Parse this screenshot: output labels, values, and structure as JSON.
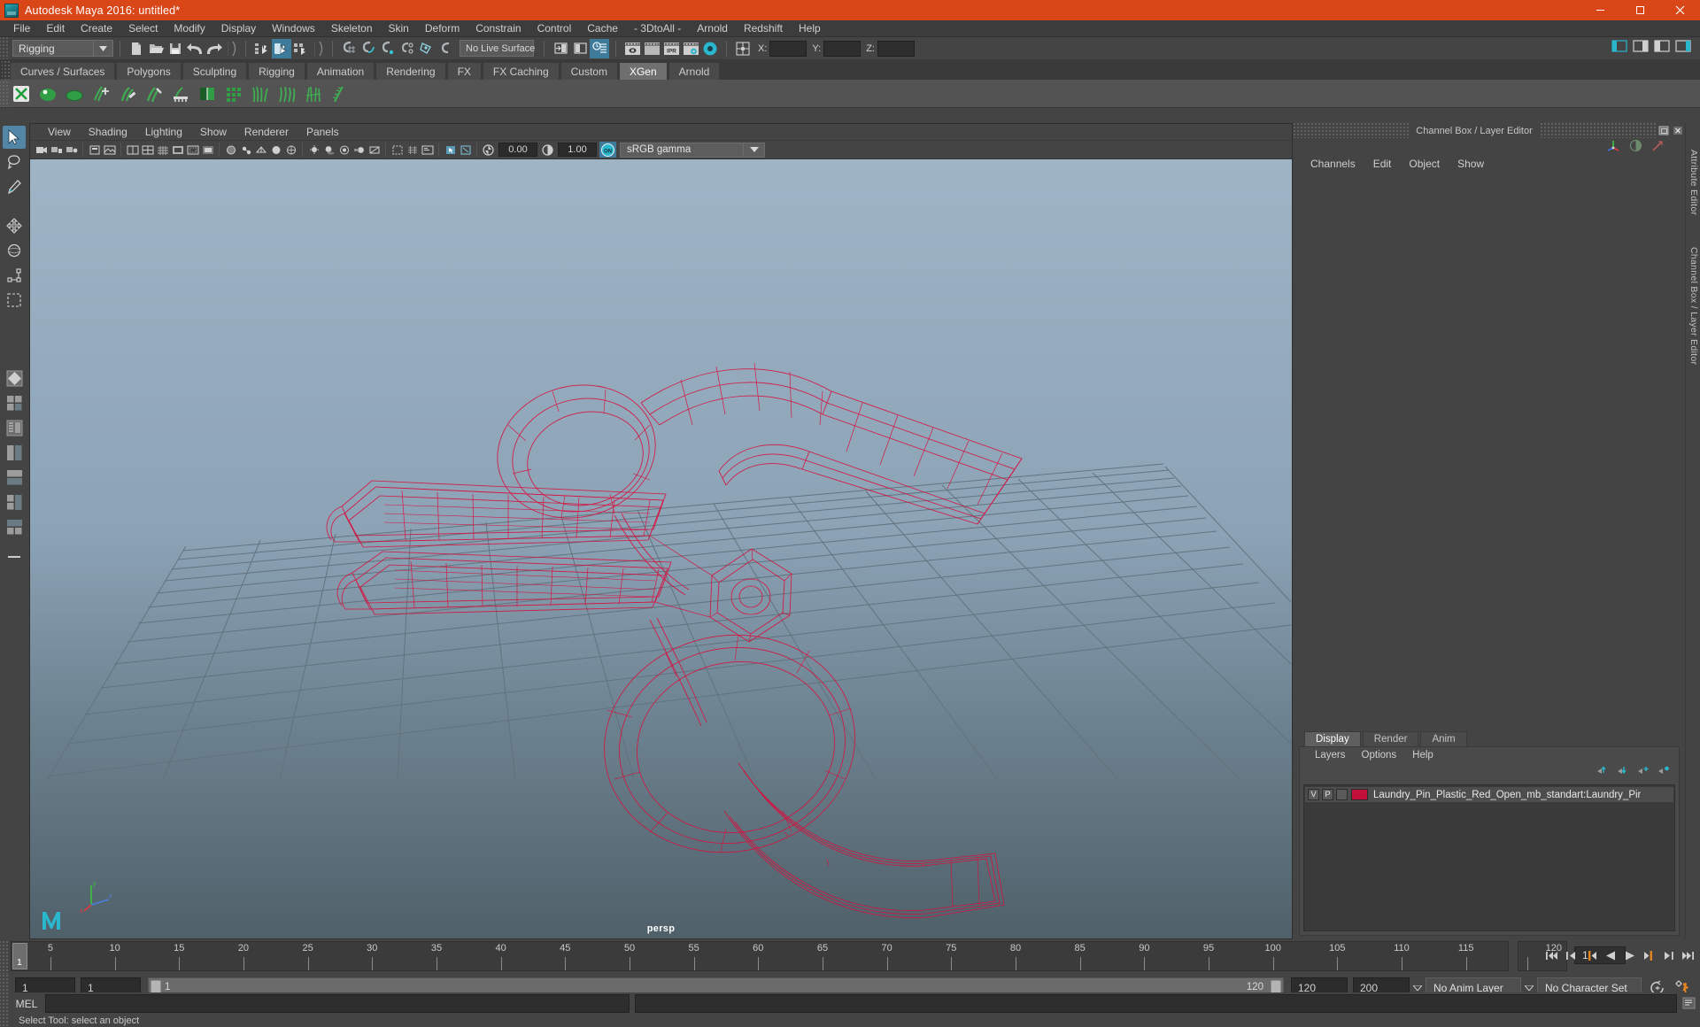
{
  "window": {
    "title": "Autodesk Maya 2016: untitled*",
    "app_icon": "maya-logo-icon",
    "minimize": "minimize-icon",
    "maximize": "maximize-icon",
    "close": "close-icon",
    "titlebar_color": "#d94618"
  },
  "menu": {
    "items": [
      "File",
      "Edit",
      "Create",
      "Select",
      "Modify",
      "Display",
      "Windows",
      "Skeleton",
      "Skin",
      "Deform",
      "Constrain",
      "Control",
      "Cache",
      "- 3DtoAll -",
      "Arnold",
      "Redshift",
      "Help"
    ]
  },
  "toolbar": {
    "mode_menu": "Rigging",
    "live_surface": "No Live Surface",
    "coord_x_label": "X:",
    "coord_y_label": "Y:",
    "coord_z_label": "Z:",
    "coord_x_value": "",
    "coord_y_value": "",
    "coord_z_value": "",
    "icons": [
      "new-scene-icon",
      "open-scene-icon",
      "save-scene-icon",
      "undo-icon",
      "redo-icon",
      "select-by-hierarchy-icon",
      "select-by-object-icon",
      "select-by-component-icon",
      "snap-to-grid-icon",
      "snap-to-curve-icon",
      "snap-to-point-icon",
      "snap-to-projected-center-icon",
      "snap-to-view-plane-icon",
      "make-live-icon",
      "render-view-icon",
      "render-region-icon",
      "render-settings-icon",
      "render-current-frame-icon",
      "render-sequence-icon",
      "ipr-render-icon",
      "render-setup-icon",
      "hypershade-icon",
      "input-output-toggle-icon"
    ]
  },
  "shelf": {
    "tabs": [
      "Curves / Surfaces",
      "Polygons",
      "Sculpting",
      "Rigging",
      "Animation",
      "Rendering",
      "FX",
      "FX Caching",
      "Custom",
      "XGen",
      "Arnold"
    ],
    "active_tab": "XGen",
    "icons": [
      "xgen-description-icon",
      "xgen-preview-icon",
      "xgen-spline-icon",
      "xgen-add-guide-icon",
      "xgen-brush-icon",
      "xgen-sculpt-icon",
      "xgen-comb-icon",
      "xgen-mask-icon",
      "xgen-density-icon",
      "xgen-grass-icon",
      "xgen-fur-icon",
      "xgen-hair-icon",
      "xgen-feather-icon"
    ]
  },
  "toolbox": {
    "tools": [
      {
        "name": "select-tool",
        "label": "Select Tool",
        "selected": true
      },
      {
        "name": "lasso-select-tool",
        "label": "Lasso Select Tool",
        "selected": false
      },
      {
        "name": "paint-select-tool",
        "label": "Paint Select Tool",
        "selected": false
      },
      {
        "name": "move-tool",
        "label": "Move Tool",
        "selected": false
      },
      {
        "name": "rotate-tool",
        "label": "Rotate Tool",
        "selected": false
      },
      {
        "name": "scale-tool",
        "label": "Scale Tool",
        "selected": false
      },
      {
        "name": "last-tool-used",
        "label": "Last Tool Used",
        "selected": false
      }
    ],
    "layouts": [
      {
        "name": "single-perspective-layout"
      },
      {
        "name": "four-view-layout"
      },
      {
        "name": "persp-outliner-layout"
      },
      {
        "name": "two-pane-side-layout"
      },
      {
        "name": "two-pane-stacked-layout"
      },
      {
        "name": "three-pane-split-layout"
      },
      {
        "name": "hypershade-persp-layout"
      },
      {
        "name": "more-layouts"
      }
    ]
  },
  "viewport": {
    "menu": [
      "View",
      "Shading",
      "Lighting",
      "Show",
      "Renderer",
      "Panels"
    ],
    "camera_label": "persp",
    "exposure_value": "0.00",
    "gamma_value": "1.00",
    "color_management": "sRGB gamma",
    "gamma_toggle": "ON",
    "toolbar_icons": [
      "select-camera-icon",
      "lock-camera-icon",
      "camera-attributes-icon",
      "bookmark-icon",
      "image-plane-icon",
      "two-pane-icon",
      "four-pane-icon",
      "grid-toggle-icon",
      "film-gate-icon",
      "resolution-gate-icon",
      "gate-mask-icon",
      "xray-icon",
      "joints-xray-icon",
      "wireframe-icon",
      "smooth-shade-icon",
      "shaded-textured-icon",
      "lights-icon",
      "shadows-icon",
      "ao-icon",
      "motion-blur-icon",
      "multisample-icon",
      "isolate-select-icon",
      "grid-icon",
      "hud-icon",
      "exposure-icon",
      "gamma-icon",
      "color-management-toggle-icon"
    ],
    "model": {
      "name": "Laundry_Pin_Plastic_Red_Open",
      "display_mode": "wireframe",
      "wire_color": "#d6123f"
    }
  },
  "channel_box": {
    "panel_title": "Channel Box / Layer Editor",
    "menu": [
      "Channels",
      "Edit",
      "Object",
      "Show"
    ],
    "float_icon": "undock-icon",
    "close_icon": "close-panel-icon",
    "header_icons": [
      "manipulator-icon",
      "toggle-icon",
      "attribute-icon"
    ],
    "empty": true
  },
  "layer_editor": {
    "tabs": [
      "Display",
      "Render",
      "Anim"
    ],
    "active_tab": "Display",
    "menu": [
      "Layers",
      "Options",
      "Help"
    ],
    "icons": [
      "move-layer-up-icon",
      "move-layer-down-icon",
      "new-layer-icon",
      "new-layer-from-selected-icon"
    ],
    "layers": [
      {
        "visibility": "V",
        "playback": "P",
        "shading": "",
        "color": "#c3103a",
        "name": "Laundry_Pin_Plastic_Red_Open_mb_standart:Laundry_Pir",
        "selected": true
      }
    ]
  },
  "docks": {
    "attribute_editor": "Attribute Editor",
    "channel_box_layer_editor": "Channel Box / Layer Editor"
  },
  "time_slider": {
    "tick_labels": [
      "1",
      "5",
      "10",
      "15",
      "20",
      "25",
      "30",
      "35",
      "40",
      "45",
      "50",
      "55",
      "60",
      "65",
      "70",
      "75",
      "80",
      "85",
      "90",
      "95",
      "100",
      "105",
      "110",
      "115",
      "120"
    ],
    "current_frame": "1",
    "end_display": "120",
    "current_frame_field": "1",
    "playback_buttons": [
      "go-to-start-icon",
      "step-back-keyframe-icon",
      "step-back-frame-icon",
      "play-backwards-icon",
      "play-forwards-icon",
      "step-forward-frame-icon",
      "step-forward-keyframe-icon",
      "go-to-end-icon"
    ]
  },
  "range_slider": {
    "anim_start": "1",
    "range_start": "1",
    "range_bar_start_label": "1",
    "range_bar_end_label": "120",
    "range_end": "120",
    "anim_end": "200",
    "anim_layer": "No Anim Layer",
    "character_set": "No Character Set",
    "auto_key_icon": "auto-keyframe-icon",
    "anim_prefs_icon": "animation-preferences-icon"
  },
  "command_line": {
    "language": "MEL",
    "input_value": "",
    "output_value": "",
    "script_editor_icon": "script-editor-icon"
  },
  "status_bar": {
    "message": "Select Tool: select an object"
  }
}
